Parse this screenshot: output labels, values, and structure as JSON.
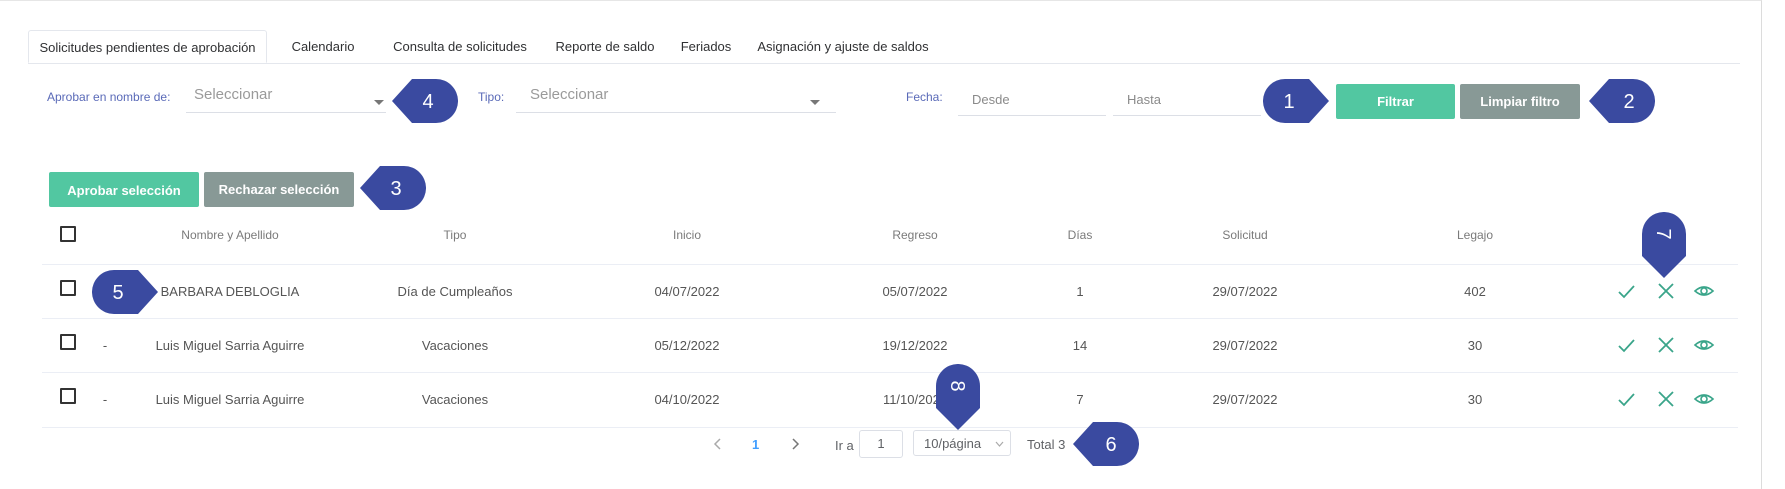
{
  "tabs": [
    {
      "label": "Solicitudes pendientes de aprobación"
    },
    {
      "label": "Calendario"
    },
    {
      "label": "Consulta de solicitudes"
    },
    {
      "label": "Reporte de saldo"
    },
    {
      "label": "Feriados"
    },
    {
      "label": "Asignación y ajuste de saldos"
    }
  ],
  "filters": {
    "aprobar_label": "Aprobar en nombre de:",
    "aprobar_placeholder": "Seleccionar",
    "tipo_label": "Tipo:",
    "tipo_placeholder": "Seleccionar",
    "fecha_label": "Fecha:",
    "desde_placeholder": "Desde",
    "hasta_placeholder": "Hasta",
    "filtrar_label": "Filtrar",
    "limpiar_label": "Limpiar filtro"
  },
  "actions": {
    "aprobar_label": "Aprobar selección",
    "rechazar_label": "Rechazar selección"
  },
  "table": {
    "headers": [
      "Nombre y Apellido",
      "Tipo",
      "Inicio",
      "Regreso",
      "Días",
      "Solicitud",
      "Legajo"
    ],
    "rows": [
      {
        "prefix": "",
        "name": "BARBARA DEBLOGLIA",
        "tipo": "Día de Cumpleaños",
        "inicio": "04/07/2022",
        "regreso": "05/07/2022",
        "dias": "1",
        "solicitud": "29/07/2022",
        "legajo": "402"
      },
      {
        "prefix": "-",
        "name": "Luis Miguel Sarria Aguirre",
        "tipo": "Vacaciones",
        "inicio": "05/12/2022",
        "regreso": "19/12/2022",
        "dias": "14",
        "solicitud": "29/07/2022",
        "legajo": "30"
      },
      {
        "prefix": "-",
        "name": "Luis Miguel Sarria Aguirre",
        "tipo": "Vacaciones",
        "inicio": "04/10/2022",
        "regreso": "11/10/2022",
        "dias": "7",
        "solicitud": "29/07/2022",
        "legajo": "30"
      }
    ]
  },
  "pagination": {
    "current_page": "1",
    "goto_label": "Ir a",
    "goto_value": "1",
    "page_size": "10/página",
    "total": "Total 3"
  },
  "markers": [
    "1",
    "2",
    "3",
    "4",
    "5",
    "6",
    "7",
    "8"
  ],
  "colors": {
    "accent_green": "#52c7a1",
    "button_gray": "#889996",
    "marker_blue": "#3a4aa0",
    "action_icon": "#3aa58a",
    "label_blue": "#5a6ab8"
  },
  "icons": [
    "check-icon",
    "close-icon",
    "eye-icon",
    "chevron-left-icon",
    "chevron-right-icon",
    "chevron-down-icon"
  ]
}
